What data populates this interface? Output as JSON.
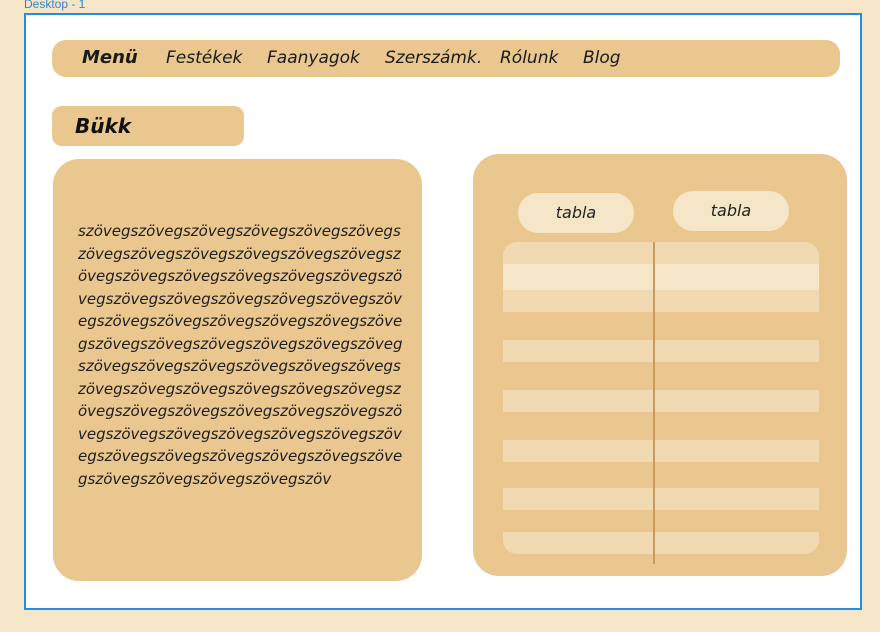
{
  "frame": {
    "label": "Desktop - 1"
  },
  "nav": {
    "items": [
      {
        "label": "Menü"
      },
      {
        "label": "Festékek"
      },
      {
        "label": "Faanyagok"
      },
      {
        "label": "Szerszámk."
      },
      {
        "label": "Rólunk"
      },
      {
        "label": "Blog"
      }
    ]
  },
  "section": {
    "title": "Bükk"
  },
  "content": {
    "body": "szövegszövegszövegszövegszövegszövegszövegszövegszövegszövegszövegszövegszövegszövegszövegszövegszövegszövegszövegszövegszövegszövegszövegszövegszövegszövegszövegszövegszövegszövegszövegszövegszövegszövegszövegszövegszövegszövegszövegszövegszövegszövegszövegszövegszövegszövegszövegszövegszövegszövegszövegszövegszövegszövegszövegszövegszövegszövegszövegszövegszövegszövegszövegszövegszövegszövegszövegszövegszövegszövegszövegszövegszöv"
  },
  "table": {
    "buttons": [
      {
        "label": "tabla"
      },
      {
        "label": "tabla"
      }
    ],
    "rows": 7
  },
  "colors": {
    "background": "#f5e6c8",
    "accent": "#e9c78f",
    "frame_border": "#1f8ee6",
    "row_fill": "#f1d9b1"
  }
}
